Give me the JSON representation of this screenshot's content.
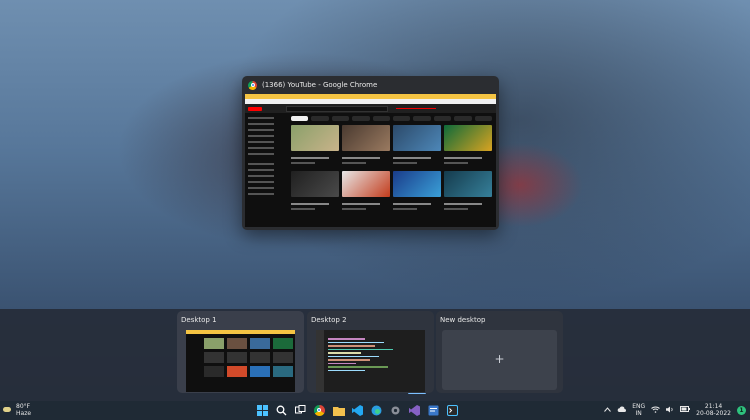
{
  "window": {
    "title": "(1366) YouTube - Google Chrome"
  },
  "taskview": {
    "desktops": [
      {
        "label": "Desktop 1",
        "active": true
      },
      {
        "label": "Desktop 2",
        "active": false
      }
    ],
    "new_desktop": {
      "label": "New desktop",
      "plus": "+"
    }
  },
  "taskbar": {
    "weather": {
      "temp": "80°F",
      "condition": "Haze"
    },
    "pinned": [
      {
        "name": "start",
        "icon": "windows-logo-icon"
      },
      {
        "name": "search",
        "icon": "search-icon"
      },
      {
        "name": "task-view",
        "icon": "task-view-icon"
      },
      {
        "name": "chrome",
        "icon": "chrome-icon"
      },
      {
        "name": "file-explorer",
        "icon": "folder-icon"
      },
      {
        "name": "vscode",
        "icon": "vscode-icon"
      },
      {
        "name": "edge",
        "icon": "edge-icon"
      },
      {
        "name": "settings",
        "icon": "gear-icon"
      },
      {
        "name": "visual-studio",
        "icon": "visual-studio-icon"
      },
      {
        "name": "app",
        "icon": "app-window-icon"
      },
      {
        "name": "terminal",
        "icon": "terminal-icon"
      }
    ],
    "tray": {
      "lang_line1": "ENG",
      "lang_line2": "IN",
      "time": "21:14",
      "date": "20-08-2022",
      "notifications": "1"
    }
  },
  "colors": {
    "accent": "#7cc0ff",
    "taskbar_bg": "#1f2a35",
    "taskview_bg": "#262c38"
  }
}
